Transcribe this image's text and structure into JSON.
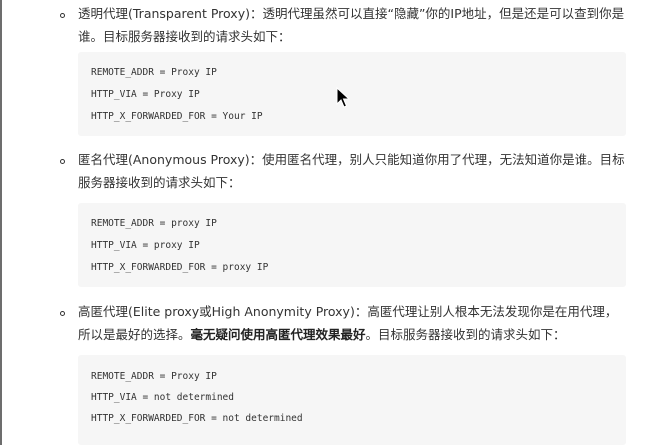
{
  "items": [
    {
      "label": "透明代理(Transparent Proxy)：透明代理虽然可以直接“隐藏”你的IP地址，但是还是可以查到你是谁。目标服务器接收到的请求头如下：",
      "code": [
        "REMOTE_ADDR = Proxy IP",
        "HTTP_VIA = Proxy IP",
        "HTTP_X_FORWARDED_FOR = Your IP"
      ]
    },
    {
      "label": "匿名代理(Anonymous Proxy)：使用匿名代理，别人只能知道你用了代理，无法知道你是谁。目标服务器接收到的请求头如下：",
      "code": [
        "REMOTE_ADDR = proxy IP",
        "HTTP_VIA = proxy IP",
        "HTTP_X_FORWARDED_FOR = proxy IP"
      ]
    },
    {
      "label_before": "高匿代理(Elite proxy或High Anonymity Proxy)：高匿代理让别人根本无法发现你是在用代理，所以是最好的选择。",
      "label_bold": "毫无疑问使用高匿代理效果最好",
      "label_after": "。目标服务器接收到的请求头如下：",
      "code": [
        "REMOTE_ADDR = Proxy IP",
        "HTTP_VIA = not determined",
        "HTTP_X_FORWARDED_FOR = not determined"
      ]
    }
  ],
  "colors": {
    "code_background": "#f6f6f6",
    "text": "#333333"
  },
  "icons": {
    "cursor": "mouse-pointer-icon"
  }
}
